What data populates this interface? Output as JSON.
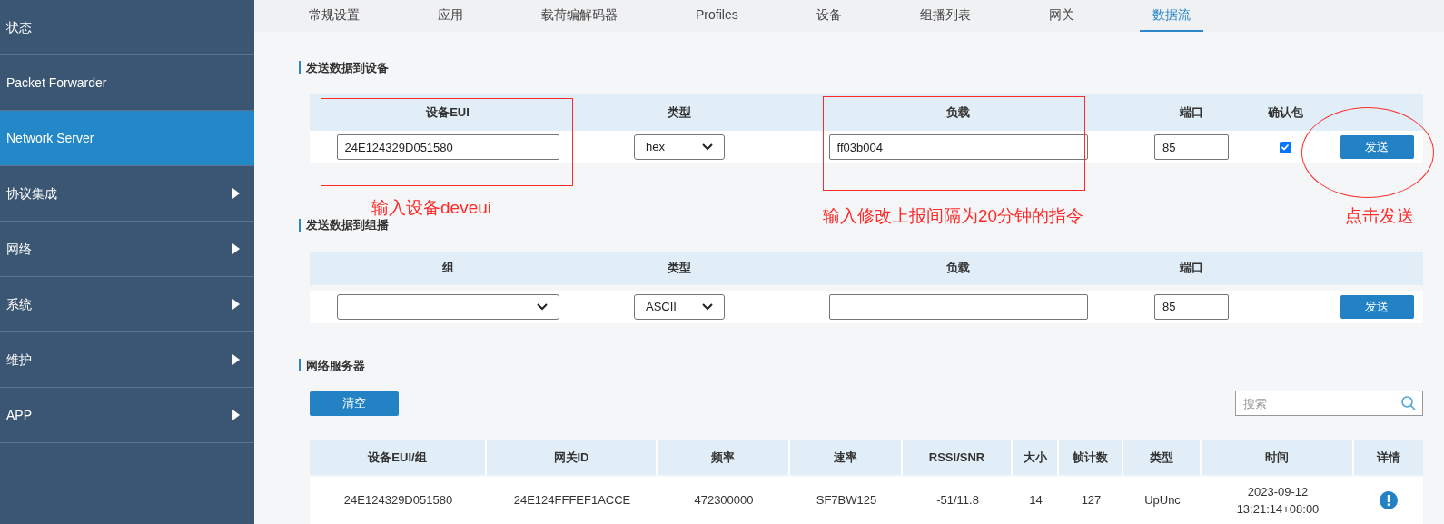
{
  "sidebar": {
    "items": [
      {
        "label": "状态",
        "selected": false,
        "has_submenu": false
      },
      {
        "label": "Packet Forwarder",
        "selected": false,
        "has_submenu": false
      },
      {
        "label": "Network Server",
        "selected": true,
        "has_submenu": false
      },
      {
        "label": "协议集成",
        "selected": false,
        "has_submenu": true
      },
      {
        "label": "网络",
        "selected": false,
        "has_submenu": true
      },
      {
        "label": "系统",
        "selected": false,
        "has_submenu": true
      },
      {
        "label": "维护",
        "selected": false,
        "has_submenu": true
      },
      {
        "label": "APP",
        "selected": false,
        "has_submenu": true
      }
    ]
  },
  "tabs": [
    {
      "label": "常规设置",
      "selected": false
    },
    {
      "label": "应用",
      "selected": false
    },
    {
      "label": "载荷编解码器",
      "selected": false
    },
    {
      "label": "Profiles",
      "selected": false
    },
    {
      "label": "设备",
      "selected": false
    },
    {
      "label": "组播列表",
      "selected": false
    },
    {
      "label": "网关",
      "selected": false
    },
    {
      "label": "数据流",
      "selected": true
    }
  ],
  "send_to_device": {
    "title": "发送数据到设备",
    "columns": [
      "设备EUI",
      "类型",
      "负载",
      "端口",
      "确认包"
    ],
    "device_eui": "24E124329D051580",
    "type": "hex",
    "payload": "ff03b004",
    "port": "85",
    "confirmed": true,
    "button": "发送"
  },
  "send_to_multicast": {
    "title": "发送数据到组播",
    "columns": [
      "组",
      "类型",
      "负载",
      "端口"
    ],
    "type": "ASCII",
    "port": "85",
    "button": "发送"
  },
  "annotations": [
    {
      "text": "输入设备deveui"
    },
    {
      "text": "输入修改上报间隔为20分钟的指令"
    },
    {
      "text": "点击发送"
    }
  ],
  "network_server": {
    "title": "网络服务器",
    "clear_button": "清空",
    "search": {
      "placeholder": "搜索"
    },
    "columns": [
      "设备EUI/组",
      "网关ID",
      "频率",
      "速率",
      "RSSI/SNR",
      "大小",
      "帧计数",
      "类型",
      "时间",
      "详情"
    ],
    "rows": [
      {
        "cells": [
          "24E124329D051580",
          "24E124FFFEF1ACCE",
          "472300000",
          "SF7BW125",
          "-51/11.8",
          "14",
          "127",
          "UpUnc",
          "2023-09-12 13:21:14+08:00"
        ]
      }
    ]
  }
}
